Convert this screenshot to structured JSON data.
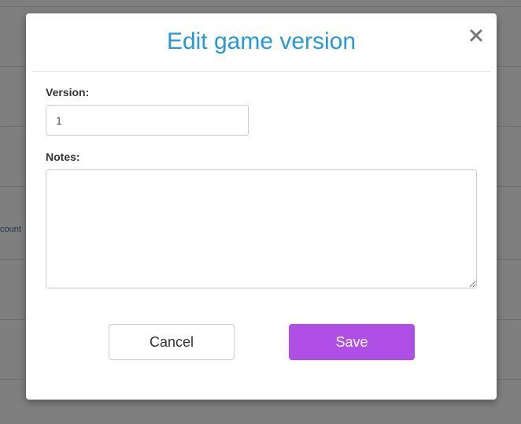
{
  "background": {
    "partial_link_text": "count"
  },
  "modal": {
    "title": "Edit game version",
    "close_glyph": "×",
    "version": {
      "label": "Version:",
      "value": "1"
    },
    "notes": {
      "label": "Notes:",
      "value": ""
    },
    "buttons": {
      "cancel_label": "Cancel",
      "save_label": "Save"
    }
  },
  "colors": {
    "title": "#2b99d1",
    "save_button": "#b04fe6",
    "overlay_background": "#7f7f7f"
  },
  "icons": {
    "close": "close-icon",
    "resize": "resize-grip-icon"
  }
}
